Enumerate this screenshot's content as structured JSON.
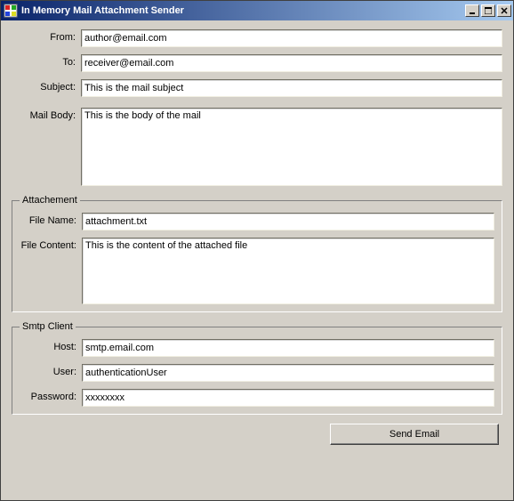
{
  "window": {
    "title": "In Memory Mail Attachment Sender"
  },
  "labels": {
    "from": "From:",
    "to": "To:",
    "subject": "Subject:",
    "mailBody": "Mail Body:",
    "attachmentGroup": "Attachement",
    "fileName": "File Name:",
    "fileContent": "File Content:",
    "smtpGroup": "Smtp Client",
    "host": "Host:",
    "user": "User:",
    "password": "Password:",
    "sendButton": "Send Email"
  },
  "values": {
    "from": "author@email.com",
    "to": "receiver@email.com",
    "subject": "This is the mail subject",
    "mailBody": "This is the body of the mail",
    "fileName": "attachment.txt",
    "fileContent": "This is the content of the attached file",
    "host": "smtp.email.com",
    "user": "authenticationUser",
    "password": "xxxxxxxx"
  }
}
